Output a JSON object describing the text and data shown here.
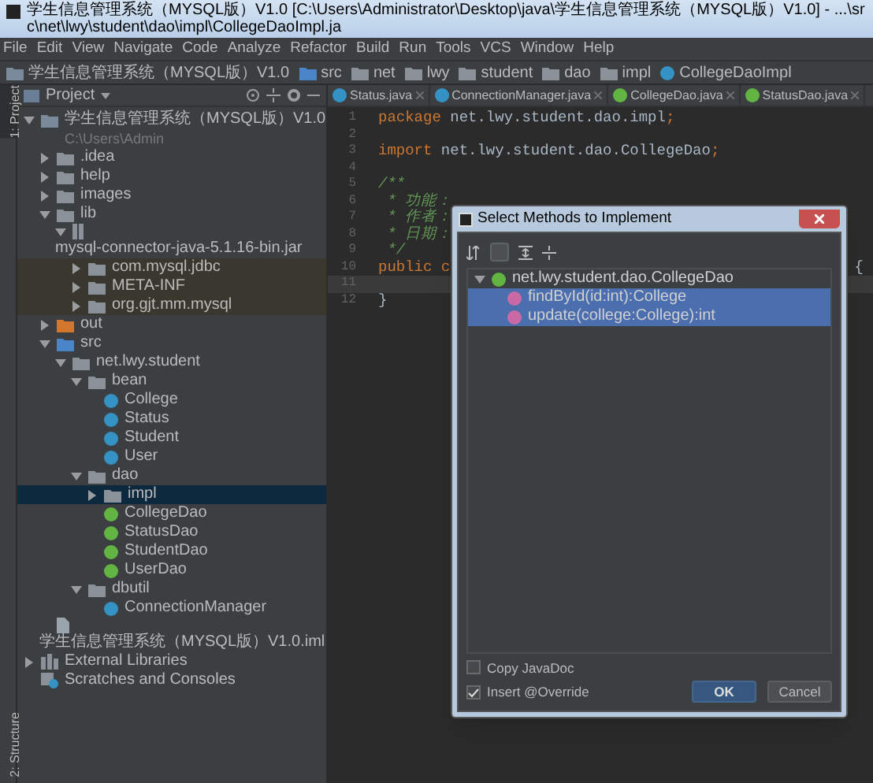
{
  "window": {
    "title": "学生信息管理系统（MYSQL版）V1.0 [C:\\Users\\Administrator\\Desktop\\java\\学生信息管理系统（MYSQL版）V1.0] - ...\\src\\net\\lwy\\student\\dao\\impl\\CollegeDaoImpl.ja"
  },
  "menu": [
    "File",
    "Edit",
    "View",
    "Navigate",
    "Code",
    "Analyze",
    "Refactor",
    "Build",
    "Run",
    "Tools",
    "VCS",
    "Window",
    "Help"
  ],
  "breadcrumb": [
    {
      "label": "学生信息管理系统（MYSQL版）V1.0",
      "kind": "module"
    },
    {
      "label": "src",
      "kind": "folder-source"
    },
    {
      "label": "net",
      "kind": "folder"
    },
    {
      "label": "lwy",
      "kind": "folder"
    },
    {
      "label": "student",
      "kind": "folder"
    },
    {
      "label": "dao",
      "kind": "folder"
    },
    {
      "label": "impl",
      "kind": "folder"
    },
    {
      "label": "CollegeDaoImpl",
      "kind": "class"
    }
  ],
  "side_strips": {
    "top": "1: Project",
    "bottom": "2: Structure"
  },
  "project_panel": {
    "title": "Project",
    "tree": [
      {
        "label": "学生信息管理系统（MYSQL版）V1.0",
        "hint": "C:\\Users\\Admin",
        "kind": "module",
        "expanded": true,
        "selected": false,
        "children": [
          {
            "label": ".idea",
            "kind": "folder",
            "expanded": false,
            "selected": false
          },
          {
            "label": "help",
            "kind": "folder",
            "expanded": false,
            "selected": false
          },
          {
            "label": "images",
            "kind": "folder",
            "expanded": false,
            "selected": false
          },
          {
            "label": "lib",
            "kind": "folder",
            "expanded": true,
            "selected": false,
            "children": [
              {
                "label": "mysql-connector-java-5.1.16-bin.jar",
                "kind": "jar",
                "expanded": true,
                "selected": false,
                "children": [
                  {
                    "label": "com.mysql.jdbc",
                    "kind": "lib-package",
                    "expanded": false,
                    "selected": false
                  },
                  {
                    "label": "META-INF",
                    "kind": "lib-package",
                    "expanded": false,
                    "selected": false
                  },
                  {
                    "label": "org.gjt.mm.mysql",
                    "kind": "lib-package",
                    "expanded": false,
                    "selected": false
                  }
                ]
              }
            ]
          },
          {
            "label": "out",
            "kind": "folder-excluded",
            "expanded": false,
            "selected": false
          },
          {
            "label": "src",
            "kind": "folder-source",
            "expanded": true,
            "selected": false,
            "children": [
              {
                "label": "net.lwy.student",
                "kind": "package",
                "expanded": true,
                "selected": false,
                "children": [
                  {
                    "label": "bean",
                    "kind": "package",
                    "expanded": true,
                    "selected": false,
                    "children": [
                      {
                        "label": "College",
                        "kind": "class",
                        "selected": false
                      },
                      {
                        "label": "Status",
                        "kind": "class",
                        "selected": false
                      },
                      {
                        "label": "Student",
                        "kind": "class",
                        "selected": false
                      },
                      {
                        "label": "User",
                        "kind": "class",
                        "selected": false
                      }
                    ]
                  },
                  {
                    "label": "dao",
                    "kind": "package",
                    "expanded": true,
                    "selected": false,
                    "children": [
                      {
                        "label": "impl",
                        "kind": "package",
                        "expanded": false,
                        "selected": true
                      },
                      {
                        "label": "CollegeDao",
                        "kind": "interface",
                        "selected": false
                      },
                      {
                        "label": "StatusDao",
                        "kind": "interface",
                        "selected": false
                      },
                      {
                        "label": "StudentDao",
                        "kind": "interface",
                        "selected": false
                      },
                      {
                        "label": "UserDao",
                        "kind": "interface",
                        "selected": false
                      }
                    ]
                  },
                  {
                    "label": "dbutil",
                    "kind": "package",
                    "expanded": true,
                    "selected": false,
                    "children": [
                      {
                        "label": "ConnectionManager",
                        "kind": "class",
                        "selected": false
                      }
                    ]
                  }
                ]
              }
            ]
          },
          {
            "label": "学生信息管理系统（MYSQL版）V1.0.iml",
            "kind": "iml",
            "selected": false
          }
        ]
      },
      {
        "label": "External Libraries",
        "kind": "libraries",
        "expanded": false,
        "selected": false
      },
      {
        "label": "Scratches and Consoles",
        "kind": "scratches",
        "selected": false
      }
    ]
  },
  "editor_tabs": [
    {
      "label": "Status.java",
      "kind": "class",
      "selected": false
    },
    {
      "label": "ConnectionManager.java",
      "kind": "class",
      "selected": false
    },
    {
      "label": "CollegeDao.java",
      "kind": "interface",
      "selected": false
    },
    {
      "label": "StatusDao.java",
      "kind": "interface",
      "selected": false
    }
  ],
  "code": [
    {
      "number": "1",
      "current": false,
      "tokens": [
        {
          "kind": "keyword",
          "text": "package"
        },
        {
          "kind": "plain",
          "text": " net.lwy.student.dao.impl"
        },
        {
          "kind": "keyword",
          "text": ";"
        }
      ]
    },
    {
      "number": "2",
      "current": false
    },
    {
      "number": "3",
      "current": false,
      "tokens": [
        {
          "kind": "keyword",
          "text": "import"
        },
        {
          "kind": "plain",
          "text": " net.lwy.student.dao.CollegeDao"
        },
        {
          "kind": "keyword",
          "text": ";"
        }
      ]
    },
    {
      "number": "4",
      "current": false
    },
    {
      "number": "5",
      "current": false,
      "tokens": [
        {
          "kind": "doc",
          "text": "/**"
        }
      ]
    },
    {
      "number": "6",
      "current": false,
      "tokens": [
        {
          "kind": "doc",
          "text": " * 功能："
        }
      ]
    },
    {
      "number": "7",
      "current": false,
      "tokens": [
        {
          "kind": "doc",
          "text": " * 作者："
        }
      ]
    },
    {
      "number": "8",
      "current": false,
      "tokens": [
        {
          "kind": "doc",
          "text": " * 日期："
        }
      ]
    },
    {
      "number": "9",
      "current": false,
      "tokens": [
        {
          "kind": "doc",
          "text": " */"
        }
      ]
    },
    {
      "number": "10",
      "current": false,
      "tokens": [
        {
          "kind": "keyword",
          "text": "public c"
        }
      ],
      "tail": "{"
    },
    {
      "number": "11",
      "current": true
    },
    {
      "number": "12",
      "current": false,
      "tokens": [
        {
          "kind": "plain",
          "text": "}"
        }
      ]
    }
  ],
  "dialog": {
    "title": "Select Methods to Implement",
    "tree": [
      {
        "label": "net.lwy.student.dao.CollegeDao",
        "kind": "interface",
        "expanded": true,
        "selected": false,
        "children": [
          {
            "label": "findById(id:int):College",
            "kind": "method",
            "selected": true
          },
          {
            "label": "update(college:College):int",
            "kind": "method",
            "selected": true
          }
        ]
      }
    ],
    "options": [
      {
        "label": "Copy JavaDoc",
        "checked": false
      },
      {
        "label": "Insert @Override",
        "checked": true
      }
    ],
    "buttons": [
      {
        "label": "OK",
        "kind": "primary"
      },
      {
        "label": "Cancel",
        "kind": "secondary"
      }
    ]
  }
}
